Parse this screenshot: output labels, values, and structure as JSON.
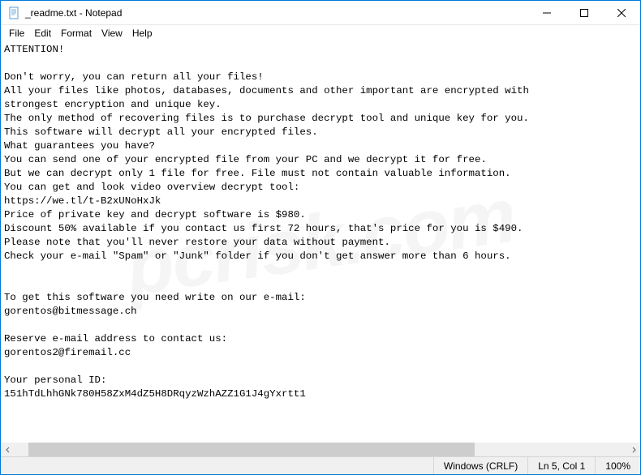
{
  "window": {
    "title": "_readme.txt - Notepad"
  },
  "menu": {
    "file": "File",
    "edit": "Edit",
    "format": "Format",
    "view": "View",
    "help": "Help"
  },
  "content": {
    "text": "ATTENTION!\n\nDon't worry, you can return all your files!\nAll your files like photos, databases, documents and other important are encrypted with \nstrongest encryption and unique key.\nThe only method of recovering files is to purchase decrypt tool and unique key for you.\nThis software will decrypt all your encrypted files.\nWhat guarantees you have?\nYou can send one of your encrypted file from your PC and we decrypt it for free.\nBut we can decrypt only 1 file for free. File must not contain valuable information.\nYou can get and look video overview decrypt tool:\nhttps://we.tl/t-B2xUNoHxJk\nPrice of private key and decrypt software is $980.\nDiscount 50% available if you contact us first 72 hours, that's price for you is $490.\nPlease note that you'll never restore your data without payment.\nCheck your e-mail \"Spam\" or \"Junk\" folder if you don't get answer more than 6 hours.\n\n\nTo get this software you need write on our e-mail:\ngorentos@bitmessage.ch\n\nReserve e-mail address to contact us:\ngorentos2@firemail.cc\n\nYour personal ID:\n151hTdLhhGNk780H58ZxM4dZ5H8DRqyzWzhAZZ1G1J4gYxrtt1"
  },
  "statusbar": {
    "encoding": "Windows (CRLF)",
    "position": "Ln 5, Col 1",
    "zoom": "100%"
  },
  "watermark": "pcrisk.com"
}
